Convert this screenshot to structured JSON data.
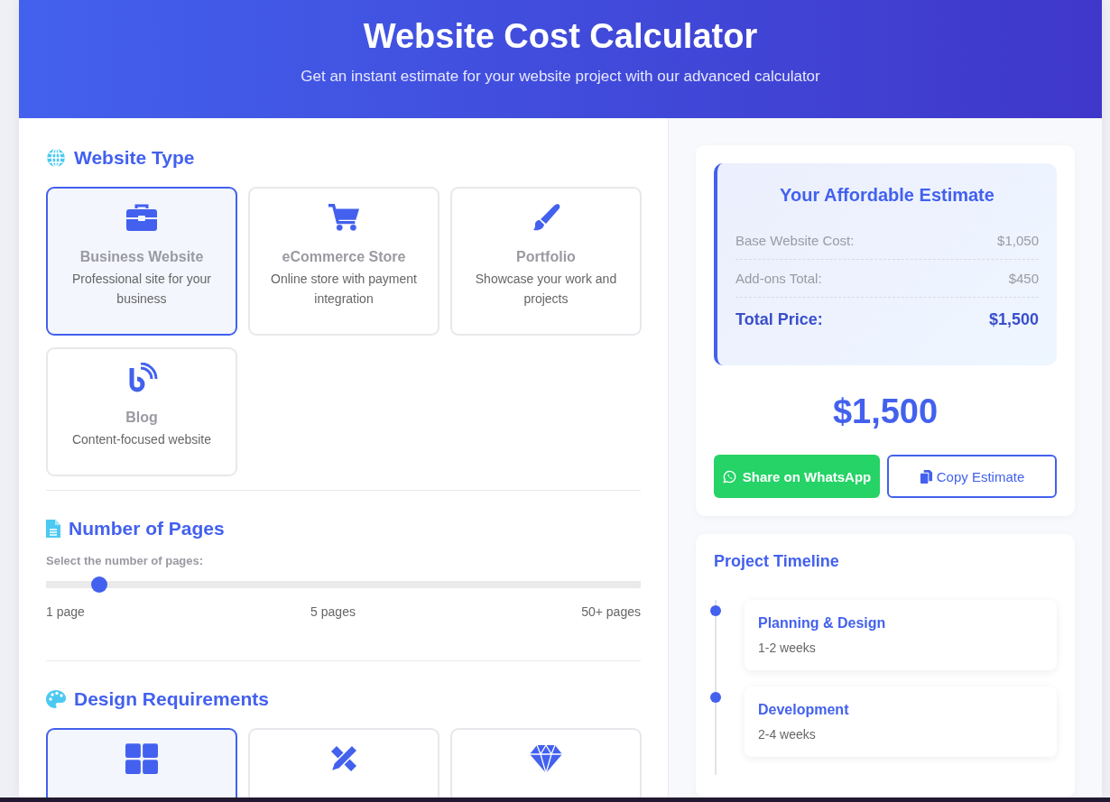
{
  "header": {
    "title": "Website Cost Calculator",
    "subtitle": "Get an instant estimate for your website project with our advanced calculator"
  },
  "website_type": {
    "heading": "Website Type",
    "options": [
      {
        "kind": "business",
        "title": "Business Website",
        "description": "Professional site for your business",
        "selected": true
      },
      {
        "kind": "ecommerce",
        "title": "eCommerce Store",
        "description": "Online store with payment integration",
        "selected": false
      },
      {
        "kind": "portfolio",
        "title": "Portfolio",
        "description": "Showcase your work and projects",
        "selected": false
      },
      {
        "kind": "blog",
        "title": "Blog",
        "description": "Content-focused website",
        "selected": false
      }
    ]
  },
  "pages": {
    "heading": "Number of Pages",
    "label": "Select the number of pages:",
    "level": 0.09,
    "marks": [
      "1 page",
      "5 pages",
      "50+ pages"
    ]
  },
  "design": {
    "heading": "Design Requirements",
    "options": [
      {
        "kind": "template",
        "selected": true
      },
      {
        "kind": "custom",
        "selected": false
      },
      {
        "kind": "premium",
        "selected": false
      }
    ]
  },
  "estimate": {
    "title": "Your Affordable Estimate",
    "rows": [
      {
        "label": "Base Website Cost:",
        "value": "$1,050"
      },
      {
        "label": "Add-ons Total:",
        "value": "$450"
      }
    ],
    "total_label": "Total Price:",
    "total_value": "$1,500",
    "big_total": "$1,500",
    "whatsapp_button": "Share on WhatsApp",
    "copy_button": "Copy Estimate"
  },
  "timeline": {
    "title": "Project Timeline",
    "steps": [
      {
        "name": "Planning & Design",
        "duration": "1-2 weeks"
      },
      {
        "name": "Development",
        "duration": "2-4 weeks"
      }
    ]
  }
}
